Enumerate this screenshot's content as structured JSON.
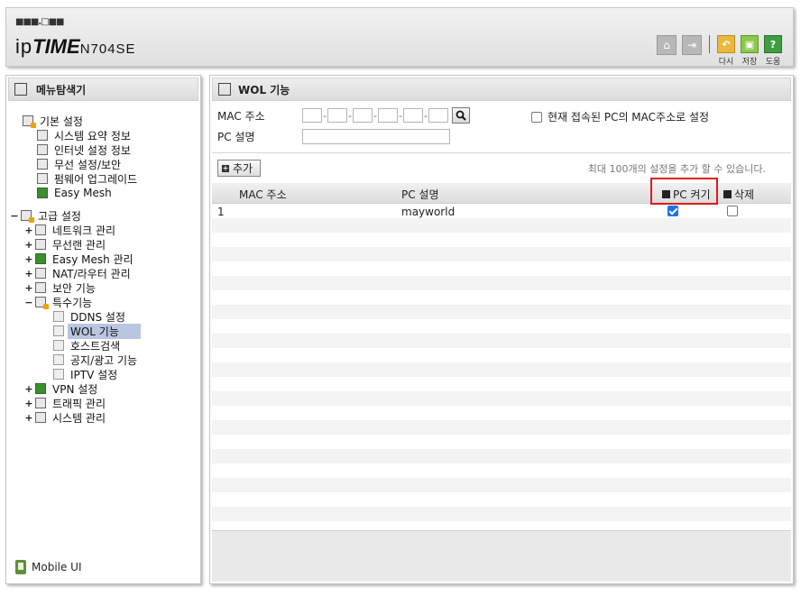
{
  "header": {
    "logo_dots": "■■■.□■■",
    "logo_ip": "ip",
    "logo_time": "TIME",
    "logo_model": "N704SE",
    "buttons": [
      {
        "label": "다시",
        "icon": "undo-icon",
        "color": "#e8b840"
      },
      {
        "label": "저장",
        "icon": "save-icon",
        "color": "#8cc84b"
      },
      {
        "label": "도움",
        "icon": "help-icon",
        "color": "#3f9e3f"
      }
    ],
    "home_icon": "home-icon",
    "logout_icon": "logout-icon"
  },
  "left_panel": {
    "title": "메뉴탐색기",
    "basic": {
      "label": "기본 설정",
      "items": [
        "시스템 요약 정보",
        "인터넷 설정 정보",
        "무선 설정/보안",
        "펌웨어 업그레이드",
        "Easy Mesh"
      ]
    },
    "advanced": {
      "toggle": "−",
      "label": "고급 설정",
      "items": [
        {
          "toggle": "+",
          "label": "네트워크 관리"
        },
        {
          "toggle": "+",
          "label": "무선랜 관리"
        },
        {
          "toggle": "+",
          "label": "Easy Mesh 관리"
        },
        {
          "toggle": "+",
          "label": "NAT/라우터 관리"
        },
        {
          "toggle": "+",
          "label": "보안 기능"
        },
        {
          "toggle": "−",
          "label": "특수기능"
        }
      ],
      "special_items": [
        "DDNS 설정",
        "WOL 기능",
        "호스트검색",
        "공지/광고 기능",
        "IPTV 설정"
      ],
      "special_selected": 1,
      "after_items": [
        {
          "toggle": "+",
          "label": "VPN 설정"
        },
        {
          "toggle": "+",
          "label": "트래픽 관리"
        },
        {
          "toggle": "+",
          "label": "시스템 관리"
        }
      ]
    },
    "mobile_ui": "Mobile UI"
  },
  "wol": {
    "title": "WOL 기능",
    "mac_label": "MAC 주소",
    "mac_fields": [
      "",
      "",
      "",
      "",
      "",
      ""
    ],
    "current_pc_label": "현재 접속된 PC의 MAC주소로 설정",
    "current_pc_checked": false,
    "pc_name_label": "PC 설명",
    "pc_name_value": "",
    "add_button": "추가",
    "max_note": "최대 100개의 설정을 추가 할 수 있습니다.",
    "columns": {
      "mac": "MAC 주소",
      "pc": "PC 설명",
      "power": "PC 켜기",
      "delete": "삭제"
    },
    "rows": [
      {
        "mac": "1",
        "pc": "mayworld",
        "power_checked": true,
        "delete_checked": false
      }
    ]
  }
}
